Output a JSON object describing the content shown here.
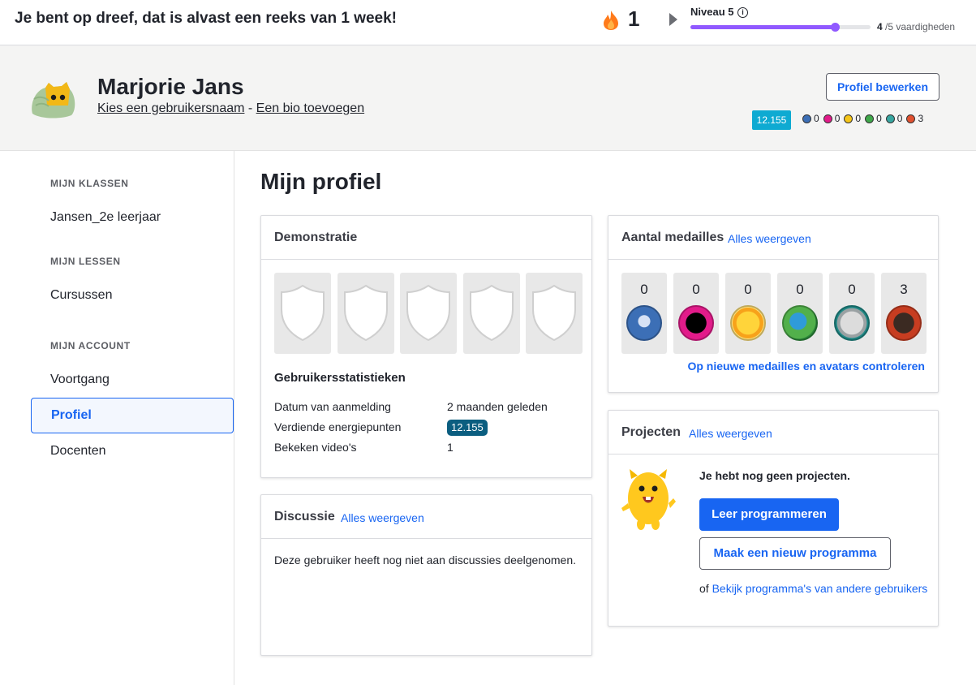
{
  "topbar": {
    "streak_message": "Je bent op dreef, dat is alvast een reeks van 1 week!",
    "streak_count": "1",
    "level_label": "Niveau 5",
    "level_progress": 0.8,
    "skills_done": "4",
    "skills_total": " /5 vaardigheden"
  },
  "header": {
    "name": "Marjorie Jans",
    "username_link": "Kies een gebruikersnaam",
    "separator": " - ",
    "bio_link": "Een bio toevoegen",
    "edit_button": "Profiel bewerken",
    "points": "12.155",
    "badges": [
      {
        "name": "meteorite-badge",
        "count": "0",
        "color": "#3c6fb6"
      },
      {
        "name": "moon-badge",
        "count": "0",
        "color": "#e21b8a"
      },
      {
        "name": "earth-badge",
        "count": "0",
        "color": "#f5c518"
      },
      {
        "name": "sun-badge",
        "count": "0",
        "color": "#3fa84a"
      },
      {
        "name": "black-hole-badge",
        "count": "0",
        "color": "#37a6a0"
      },
      {
        "name": "challenge-patch",
        "count": "3",
        "color": "#e0502f"
      }
    ]
  },
  "sidebar": {
    "section_classes": "MIJN KLASSEN",
    "class_item": "Jansen_2e leerjaar",
    "section_lessons": "MIJN LESSEN",
    "lessons_item": "Cursussen",
    "section_account": "MIJN ACCOUNT",
    "progress_item": "Voortgang",
    "profile_item": "Profiel",
    "teachers_item": "Docenten"
  },
  "main": {
    "title": "Mijn profiel",
    "demo": {
      "title": "Demonstratie",
      "stats_title": "Gebruikersstatistieken",
      "signup_label": "Datum van aanmelding",
      "signup_value": "2 maanden geleden",
      "energy_label": "Verdiende energiepunten",
      "energy_value": "12.155",
      "videos_label": "Bekeken video's",
      "videos_value": "1"
    },
    "discussion": {
      "title": "Discussie",
      "link": "Alles weergeven",
      "text": "Deze gebruiker heeft nog niet aan discussies deelgenomen."
    },
    "medals": {
      "title": "Aantal medailles",
      "link": "Alles weergeven",
      "counts": [
        "0",
        "0",
        "0",
        "0",
        "0",
        "3"
      ],
      "check_link": "Op nieuwe medailles en avatars controleren"
    },
    "projects": {
      "title": "Projecten",
      "link": "Alles weergeven",
      "empty_text": "Je hebt nog geen projecten.",
      "learn_button": "Leer programmeren",
      "new_button": "Maak een nieuw programma",
      "or_text": "of ",
      "others_link": "Bekijk programma's van andere gebruikers"
    }
  }
}
